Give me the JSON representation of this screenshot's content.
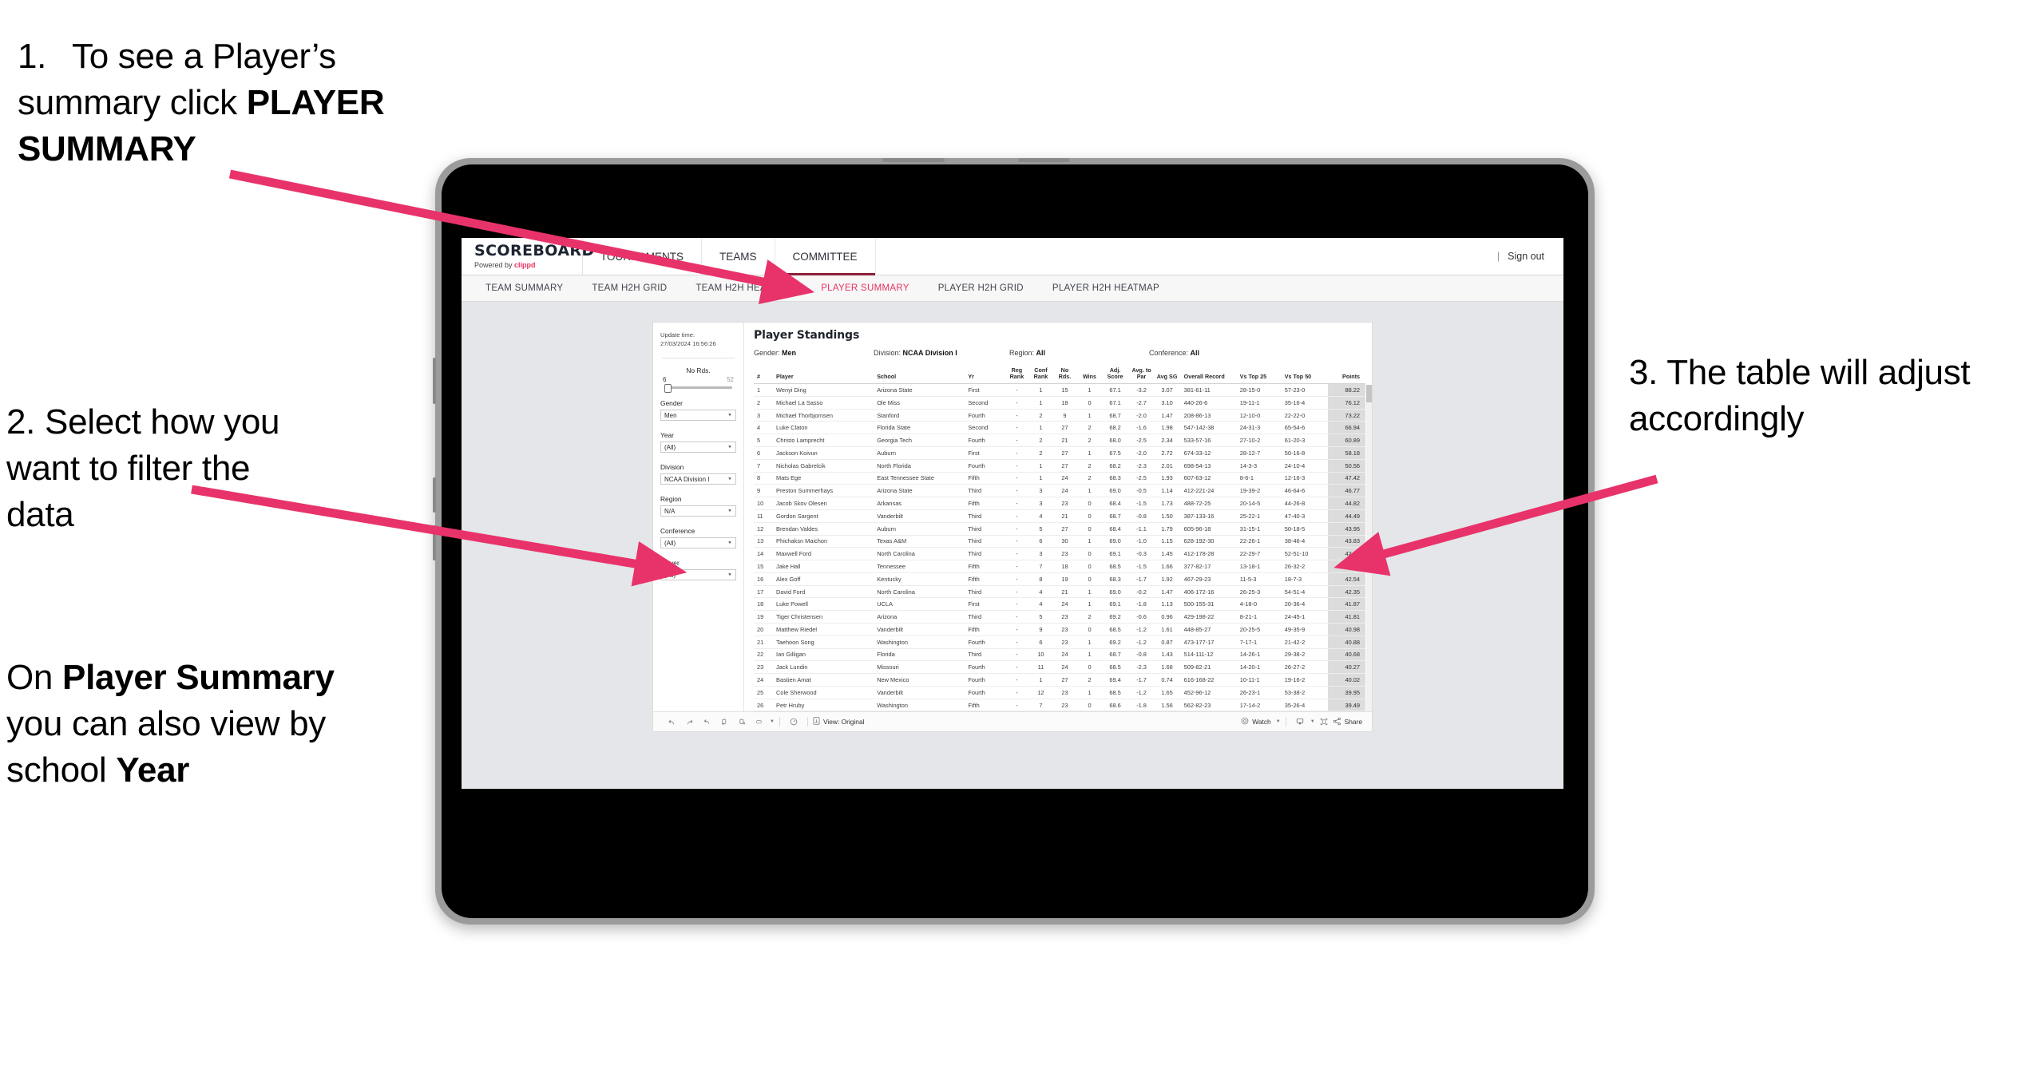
{
  "annotations": {
    "step1": {
      "number": "1.",
      "text_prefix": "To see a Player’s summary click ",
      "bold": "PLAYER SUMMARY"
    },
    "step2": "2. Select how you want to filter the data",
    "step2b": {
      "pre": "On ",
      "bold1": "Player Summary",
      "mid": " you can also view by school ",
      "bold2": "Year"
    },
    "step3": "3. The table will adjust accordingly",
    "arrow_color": "#e8336a"
  },
  "browser": {
    "brand": {
      "logo_main": "SCOREBOARD",
      "logo_sub_pre": "Powered by ",
      "logo_sub_brand": "clippd"
    },
    "nav": [
      {
        "label": "TOURNAMENTS",
        "active": false
      },
      {
        "label": "TEAMS",
        "active": false
      },
      {
        "label": "COMMITTEE",
        "active": true
      }
    ],
    "signout": {
      "sep": "|",
      "label": "Sign out"
    },
    "subnav": [
      {
        "label": "TEAM SUMMARY",
        "active": false
      },
      {
        "label": "TEAM H2H GRID",
        "active": false
      },
      {
        "label": "TEAM H2H HEATMAP",
        "active": false
      },
      {
        "label": "PLAYER SUMMARY",
        "active": true
      },
      {
        "label": "PLAYER H2H GRID",
        "active": false
      },
      {
        "label": "PLAYER H2H HEATMAP",
        "active": false
      }
    ],
    "accent_color": "#e8315f",
    "active_tab_underline": "#8e1f39"
  },
  "filters": {
    "update_label": "Update time:",
    "update_value": "27/03/2024 16:56:26",
    "slider": {
      "title": "No Rds.",
      "min": "6",
      "max": "52"
    },
    "groups": [
      {
        "label": "Gender",
        "value": "Men"
      },
      {
        "label": "Year",
        "value": "(All)"
      },
      {
        "label": "Division",
        "value": "NCAA Division I"
      },
      {
        "label": "Region",
        "value": "N/A"
      },
      {
        "label": "Conference",
        "value": "(All)"
      },
      {
        "label": "Player",
        "value": "(All)"
      }
    ]
  },
  "report": {
    "title": "Player Standings",
    "meta": [
      {
        "label": "Gender:",
        "value": "Men"
      },
      {
        "label": "Division:",
        "value": "NCAA Division I"
      },
      {
        "label": "Region:",
        "value": "All"
      },
      {
        "label": "Conference:",
        "value": "All"
      }
    ],
    "columns": [
      "#",
      "Player",
      "School",
      "Yr",
      "Reg Rank",
      "Conf Rank",
      "No Rds.",
      "Wins",
      "Adj. Score",
      "Avg. to Par",
      "Avg SG",
      "Overall Record",
      "Vs Top 25",
      "Vs Top 50",
      "Points"
    ],
    "rows": [
      [
        "1",
        "Wenyi Ding",
        "Arizona State",
        "First",
        "-",
        "1",
        "15",
        "1",
        "67.1",
        "-3.2",
        "3.07",
        "381-61-11",
        "28-15-0",
        "57-23-0",
        "88.22"
      ],
      [
        "2",
        "Michael La Sasso",
        "Ole Miss",
        "Second",
        "-",
        "1",
        "18",
        "0",
        "67.1",
        "-2.7",
        "3.10",
        "440-26-6",
        "19-11-1",
        "35-16-4",
        "76.12"
      ],
      [
        "3",
        "Michael Thorbjornsen",
        "Stanford",
        "Fourth",
        "-",
        "2",
        "9",
        "1",
        "68.7",
        "-2.0",
        "1.47",
        "208-86-13",
        "12-10-0",
        "22-22-0",
        "73.22"
      ],
      [
        "4",
        "Luke Claton",
        "Florida State",
        "Second",
        "-",
        "1",
        "27",
        "2",
        "68.2",
        "-1.6",
        "1.98",
        "547-142-38",
        "24-31-3",
        "65-54-6",
        "66.94"
      ],
      [
        "5",
        "Christo Lamprecht",
        "Georgia Tech",
        "Fourth",
        "-",
        "2",
        "21",
        "2",
        "68.0",
        "-2.5",
        "2.34",
        "533-57-16",
        "27-10-2",
        "61-20-3",
        "60.89"
      ],
      [
        "6",
        "Jackson Koivun",
        "Auburn",
        "First",
        "-",
        "2",
        "27",
        "1",
        "67.5",
        "-2.0",
        "2.72",
        "674-33-12",
        "28-12-7",
        "50-16-8",
        "58.18"
      ],
      [
        "7",
        "Nicholas Gabrelcik",
        "North Florida",
        "Fourth",
        "-",
        "1",
        "27",
        "2",
        "68.2",
        "-2.3",
        "2.01",
        "698-54-13",
        "14-3-3",
        "24-10-4",
        "50.56"
      ],
      [
        "8",
        "Mats Ege",
        "East Tennessee State",
        "Fifth",
        "-",
        "1",
        "24",
        "2",
        "68.3",
        "-2.5",
        "1.93",
        "607-63-12",
        "8-6-1",
        "12-16-3",
        "47.42"
      ],
      [
        "9",
        "Preston Summerhays",
        "Arizona State",
        "Third",
        "-",
        "3",
        "24",
        "1",
        "69.0",
        "-0.5",
        "1.14",
        "412-221-24",
        "19-39-2",
        "46-64-6",
        "46.77"
      ],
      [
        "10",
        "Jacob Skov Olesen",
        "Arkansas",
        "Fifth",
        "-",
        "3",
        "23",
        "0",
        "68.4",
        "-1.5",
        "1.73",
        "488-72-25",
        "20-14-5",
        "44-26-8",
        "44.82"
      ],
      [
        "11",
        "Gordon Sargent",
        "Vanderbilt",
        "Third",
        "-",
        "4",
        "21",
        "0",
        "68.7",
        "-0.8",
        "1.50",
        "387-133-16",
        "25-22-1",
        "47-40-3",
        "44.49"
      ],
      [
        "12",
        "Brendan Valdes",
        "Auburn",
        "Third",
        "-",
        "5",
        "27",
        "0",
        "68.4",
        "-1.1",
        "1.79",
        "605-96-18",
        "31-15-1",
        "50-18-5",
        "43.95"
      ],
      [
        "13",
        "Phichaksn Maichon",
        "Texas A&M",
        "Third",
        "-",
        "6",
        "30",
        "1",
        "69.0",
        "-1.0",
        "1.15",
        "628-192-30",
        "22-26-1",
        "38-46-4",
        "43.83"
      ],
      [
        "14",
        "Maxwell Ford",
        "North Carolina",
        "Third",
        "-",
        "3",
        "23",
        "0",
        "69.1",
        "-0.3",
        "1.45",
        "412-178-28",
        "22-29-7",
        "52-51-10",
        "42.75"
      ],
      [
        "15",
        "Jake Hall",
        "Tennessee",
        "Fifth",
        "-",
        "7",
        "18",
        "0",
        "68.5",
        "-1.5",
        "1.66",
        "377-82-17",
        "13-18-1",
        "26-32-2",
        "42.55"
      ],
      [
        "16",
        "Alex Goff",
        "Kentucky",
        "Fifth",
        "-",
        "8",
        "19",
        "0",
        "68.3",
        "-1.7",
        "1.92",
        "467-29-23",
        "11-5-3",
        "18-7-3",
        "42.54"
      ],
      [
        "17",
        "David Ford",
        "North Carolina",
        "Third",
        "-",
        "4",
        "21",
        "1",
        "69.0",
        "-0.2",
        "1.47",
        "406-172-16",
        "26-25-3",
        "54-51-4",
        "42.35"
      ],
      [
        "18",
        "Luke Powell",
        "UCLA",
        "First",
        "-",
        "4",
        "24",
        "1",
        "69.1",
        "-1.8",
        "1.13",
        "500-155-31",
        "4-18-0",
        "20-36-4",
        "41.87"
      ],
      [
        "19",
        "Tiger Christensen",
        "Arizona",
        "Third",
        "-",
        "5",
        "23",
        "2",
        "69.2",
        "-0.6",
        "0.96",
        "429-198-22",
        "8-21-1",
        "24-45-1",
        "41.81"
      ],
      [
        "20",
        "Matthew Riedel",
        "Vanderbilt",
        "Fifth",
        "-",
        "9",
        "23",
        "0",
        "68.5",
        "-1.2",
        "1.61",
        "448-85-27",
        "20-25-5",
        "49-35-9",
        "40.98"
      ],
      [
        "21",
        "Taehoon Song",
        "Washington",
        "Fourth",
        "-",
        "6",
        "23",
        "1",
        "69.2",
        "-1.2",
        "0.87",
        "473-177-17",
        "7-17-1",
        "21-42-2",
        "40.88"
      ],
      [
        "22",
        "Ian Gilligan",
        "Florida",
        "Third",
        "-",
        "10",
        "24",
        "1",
        "68.7",
        "-0.8",
        "1.43",
        "514-111-12",
        "14-26-1",
        "29-38-2",
        "40.68"
      ],
      [
        "23",
        "Jack Lundin",
        "Missouri",
        "Fourth",
        "-",
        "11",
        "24",
        "0",
        "68.5",
        "-2.3",
        "1.68",
        "509-82-21",
        "14-20-1",
        "26-27-2",
        "40.27"
      ],
      [
        "24",
        "Bastien Amat",
        "New Mexico",
        "Fourth",
        "-",
        "1",
        "27",
        "2",
        "69.4",
        "-1.7",
        "0.74",
        "616-168-22",
        "10-11-1",
        "19-16-2",
        "40.02"
      ],
      [
        "25",
        "Cole Sherwood",
        "Vanderbilt",
        "Fourth",
        "-",
        "12",
        "23",
        "1",
        "68.5",
        "-1.2",
        "1.65",
        "452-96-12",
        "26-23-1",
        "53-38-2",
        "39.95"
      ],
      [
        "26",
        "Petr Hruby",
        "Washington",
        "Fifth",
        "-",
        "7",
        "23",
        "0",
        "68.6",
        "-1.8",
        "1.56",
        "562-82-23",
        "17-14-2",
        "35-26-4",
        "39.49"
      ]
    ]
  },
  "toolbar": {
    "view_label": "View: Original",
    "watch_label": "Watch",
    "share_label": "Share"
  }
}
